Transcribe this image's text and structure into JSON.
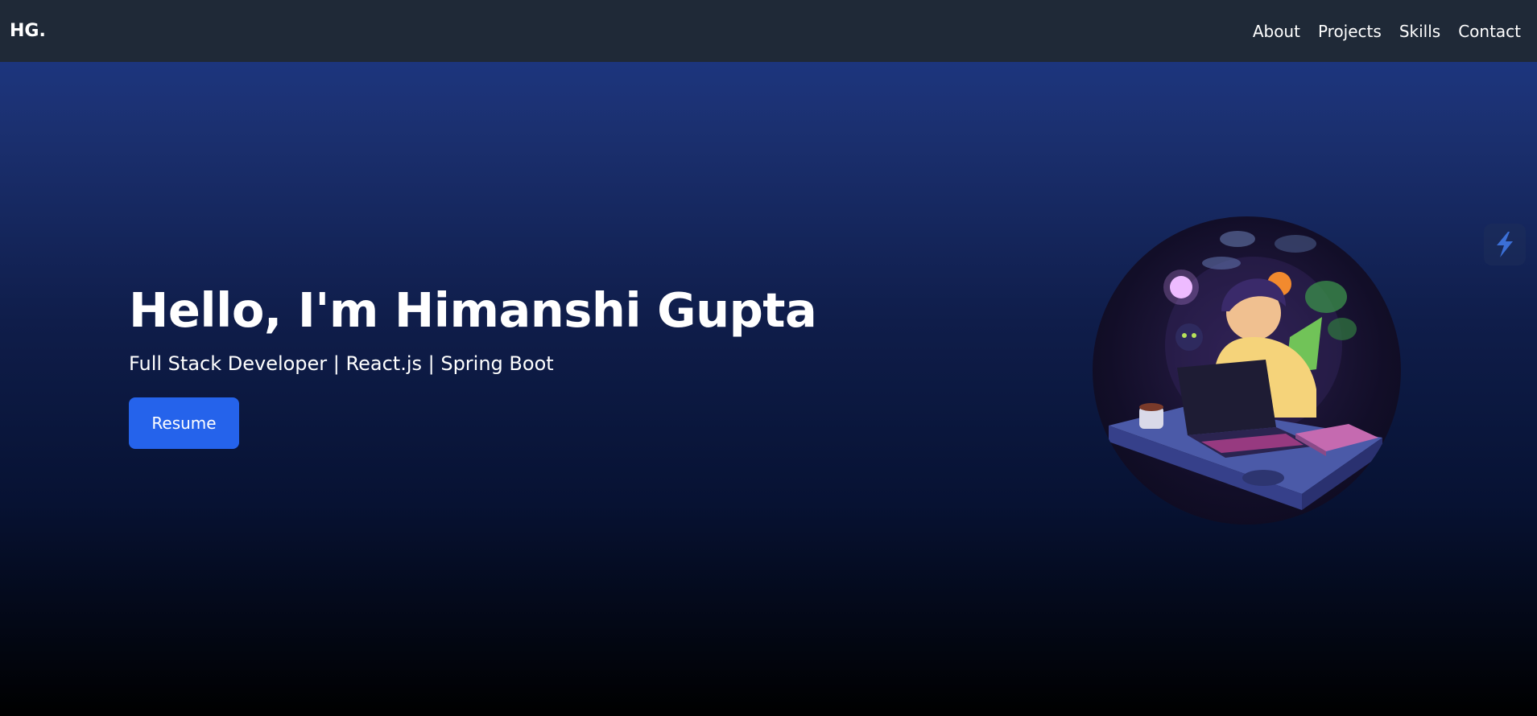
{
  "header": {
    "logo": "HG.",
    "nav": [
      {
        "label": "About"
      },
      {
        "label": "Projects"
      },
      {
        "label": "Skills"
      },
      {
        "label": "Contact"
      }
    ]
  },
  "hero": {
    "title": "Hello, I'm Himanshi Gupta",
    "subtitle": "Full Stack Developer | React.js | Spring Boot",
    "button_label": "Resume"
  },
  "colors": {
    "nav_background": "#1f2937",
    "accent": "#2563eb",
    "gradient_top": "#1e3a8a",
    "gradient_bottom": "#000000"
  },
  "icons": {
    "floating_widget": "lightning-bolt-icon",
    "avatar": "developer-illustration"
  }
}
